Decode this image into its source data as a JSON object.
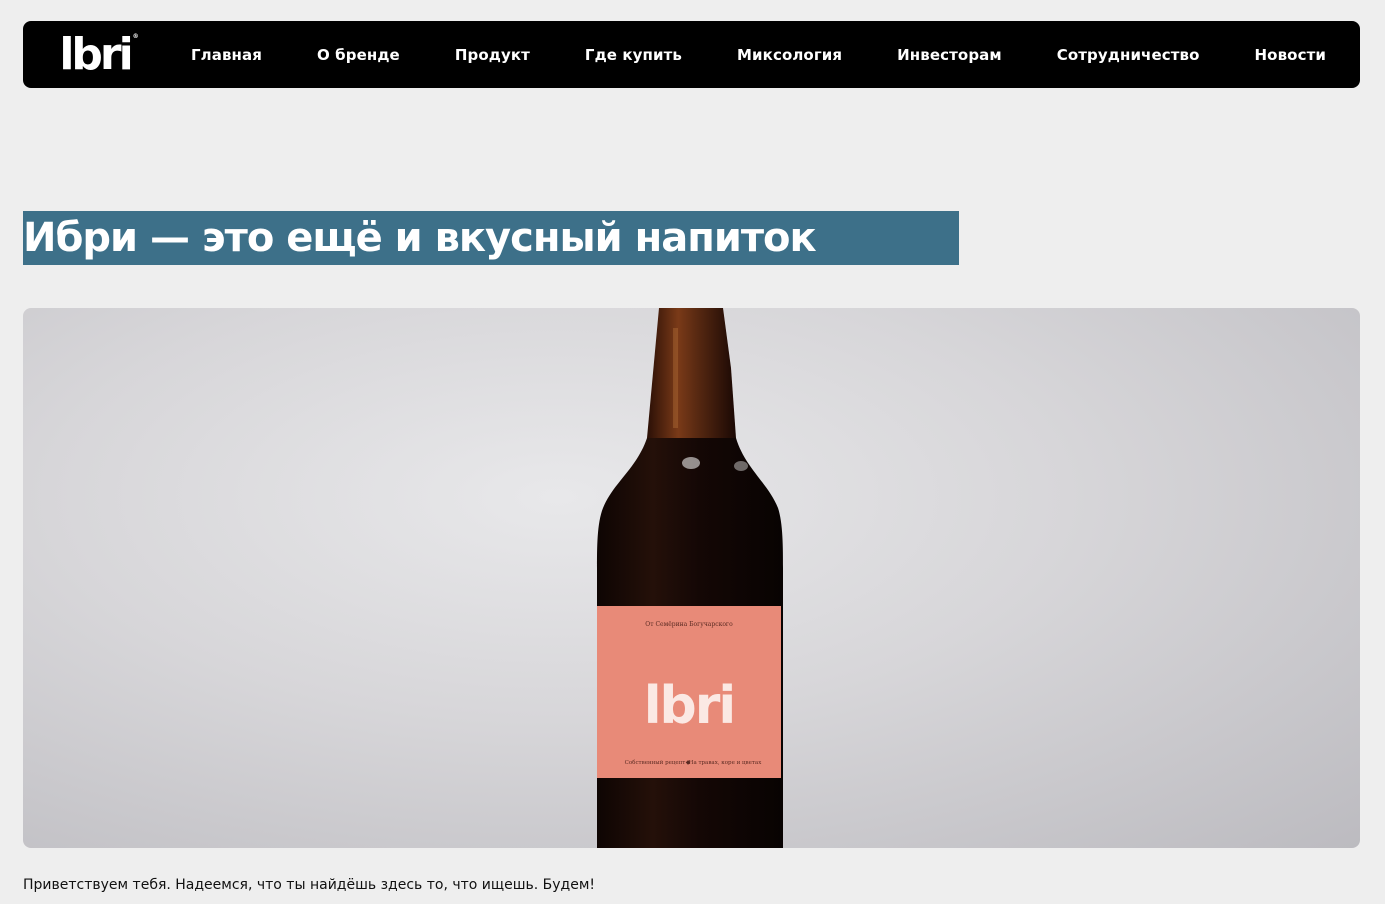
{
  "header": {
    "logo_text": "lbri",
    "logo_mark": "®",
    "nav": [
      {
        "label": "Главная"
      },
      {
        "label": "О бренде"
      },
      {
        "label": "Продукт"
      },
      {
        "label": "Где купить"
      },
      {
        "label": "Миксология"
      },
      {
        "label": "Инвесторам"
      },
      {
        "label": "Сотрудничество"
      },
      {
        "label": "Новости"
      }
    ]
  },
  "hero": {
    "title": "Ибри — это ещё и вкусный напиток"
  },
  "product_image": {
    "label_top": "От Семёрина Богучарского",
    "label_brand": "lbri",
    "label_bottom_left": "Собственный рецепт",
    "label_bottom_right": "На травах, коре и цветах",
    "colors": {
      "label": "#e88a78",
      "bottle": "#1b0a06",
      "neck": "#5a2a12"
    }
  },
  "intro": {
    "text": "Приветствуем тебя. Надеемся, что ты найдёшь здесь то, что ищешь. Будем!"
  },
  "colors": {
    "nav_bg": "#000000",
    "title_bg": "#3d7089",
    "page_bg": "#eeeeee"
  }
}
